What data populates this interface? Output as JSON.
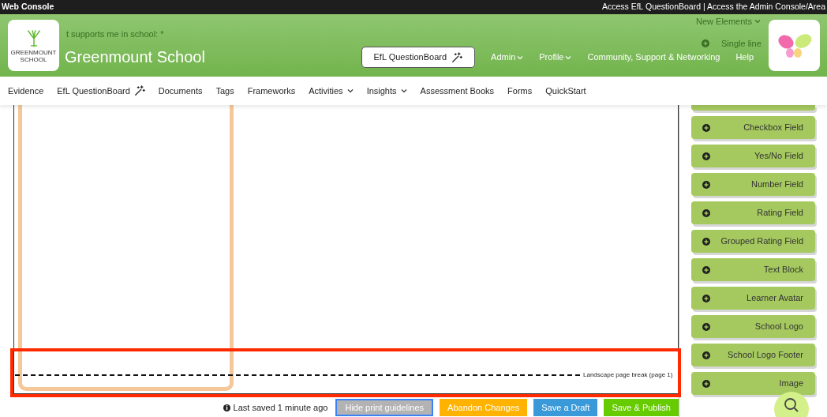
{
  "top_bar": {
    "title": "Web Console",
    "links": "Access EfL QuestionBoard | Access the Admin Console/Area"
  },
  "header": {
    "logo_text": [
      "GREENMOUNT",
      "SCHOOL"
    ],
    "school_name": "Greenmount School",
    "questionboard_button": "EfL QuestionBoard",
    "menu": [
      {
        "label": "Admin",
        "dropdown": true
      },
      {
        "label": "Profile",
        "dropdown": true
      },
      {
        "label": "Community, Support & Networking",
        "dropdown": false
      },
      {
        "label": "Help",
        "dropdown": false
      }
    ]
  },
  "nav": [
    {
      "label": "Evidence",
      "kind": "plain"
    },
    {
      "label": "EfL QuestionBoard",
      "kind": "wand"
    },
    {
      "label": "Documents",
      "kind": "plain"
    },
    {
      "label": "Tags",
      "kind": "plain"
    },
    {
      "label": "Frameworks",
      "kind": "plain"
    },
    {
      "label": "Activities",
      "kind": "dropdown"
    },
    {
      "label": "Insights",
      "kind": "dropdown"
    },
    {
      "label": "Assessment Books",
      "kind": "plain"
    },
    {
      "label": "Forms",
      "kind": "plain"
    },
    {
      "label": "QuickStart",
      "kind": "plain"
    }
  ],
  "canvas": {
    "question_label": "t supports me in school: *",
    "page_break": "Landscape page break (page 1)"
  },
  "footer": {
    "last_saved": "Last saved 1 minute ago",
    "buttons": [
      {
        "label": "Hide print guidelines",
        "kind": "toggle"
      },
      {
        "label": "Abandon Changes",
        "kind": "danger"
      },
      {
        "label": "Save a Draft",
        "kind": "draft"
      },
      {
        "label": "Save & Publish",
        "kind": "publish"
      }
    ]
  },
  "sidebar": {
    "heading": "New Elements",
    "elements": [
      {
        "kind": "ghost",
        "label": "Single line"
      },
      {
        "kind": "covered"
      },
      {
        "kind": "field",
        "label": "Checkbox Field"
      },
      {
        "kind": "field",
        "label": "Yes/No Field"
      },
      {
        "kind": "field",
        "label": "Number Field"
      },
      {
        "kind": "field",
        "label": "Rating Field"
      },
      {
        "kind": "field",
        "label": "Grouped Rating Field"
      },
      {
        "kind": "field",
        "label": "Text Block"
      },
      {
        "kind": "field",
        "label": "Learner Avatar"
      },
      {
        "kind": "field",
        "label": "School Logo"
      },
      {
        "kind": "field",
        "label": "School Logo Footer"
      },
      {
        "kind": "field",
        "label": "Image"
      }
    ]
  }
}
